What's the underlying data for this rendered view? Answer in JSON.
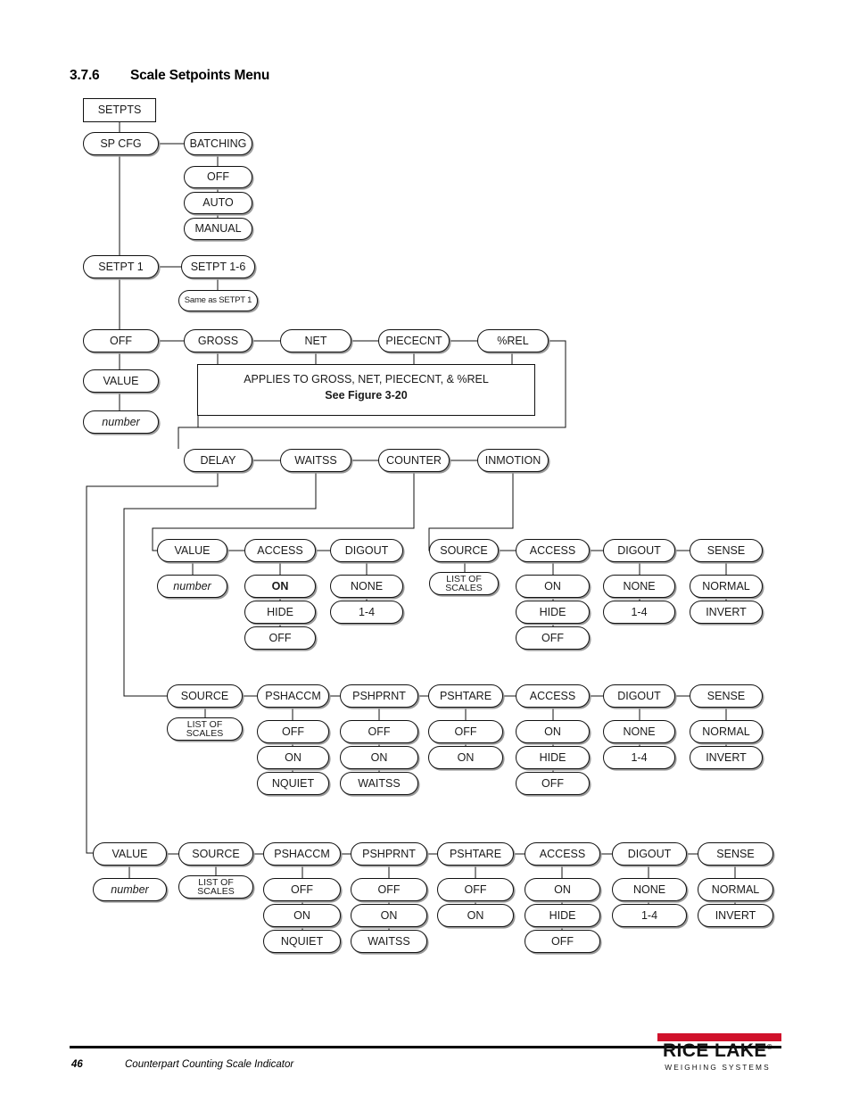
{
  "section": {
    "number": "3.7.6",
    "title": "Scale Setpoints Menu"
  },
  "footer": {
    "page": "46",
    "doc_title": "Counterpart Counting Scale Indicator",
    "logo_name": "RICE LAKE",
    "logo_tagline": "WEIGHING SYSTEMS",
    "logo_bar_color": "#d0112b"
  },
  "note": {
    "line1": "APPLIES TO GROSS, NET, PIECECNT, & %REL",
    "line2": "See Figure 3-20"
  },
  "nodes": {
    "setpts": "SETPTS",
    "sp_cfg": "SP CFG",
    "batching": "BATCHING",
    "batching_off": "OFF",
    "batching_auto": "AUTO",
    "batching_manual": "MANUAL",
    "setpt1": "SETPT 1",
    "setpt16": "SETPT 1-6",
    "same_as": "Same as SETPT 1",
    "off": "OFF",
    "gross": "GROSS",
    "net": "NET",
    "piececnt": "PIECECNT",
    "pctrel": "%REL",
    "value": "VALUE",
    "number": "number",
    "delay": "DELAY",
    "waitss": "WAITSS",
    "counter": "COUNTER",
    "inmotion": "INMOTION",
    "r1_value": "VALUE",
    "r1_number": "number",
    "r1_access": "ACCESS",
    "r1_access_on": "ON",
    "r1_access_hide": "HIDE",
    "r1_access_off": "OFF",
    "r1_digout": "DIGOUT",
    "r1_digout_none": "NONE",
    "r1_digout_14": "1-4",
    "r2_source": "SOURCE",
    "r2_list": "LIST OF SCALES",
    "r2_list_l1": "LIST OF",
    "r2_list_l2": "SCALES",
    "r2_access": "ACCESS",
    "r2_access_on": "ON",
    "r2_access_hide": "HIDE",
    "r2_access_off": "OFF",
    "r2_digout": "DIGOUT",
    "r2_digout_none": "NONE",
    "r2_digout_14": "1-4",
    "r2_sense": "SENSE",
    "r2_sense_normal": "NORMAL",
    "r2_sense_invert": "INVERT",
    "r3_source": "SOURCE",
    "r3_list_l1": "LIST OF",
    "r3_list_l2": "SCALES",
    "r3_pshaccm": "PSHACCM",
    "r3_pshaccm_off": "OFF",
    "r3_pshaccm_on": "ON",
    "r3_pshaccm_nquiet": "NQUIET",
    "r3_pshprnt": "PSHPRNT",
    "r3_pshprnt_off": "OFF",
    "r3_pshprnt_on": "ON",
    "r3_pshprnt_waitss": "WAITSS",
    "r3_pshtare": "PSHTARE",
    "r3_pshtare_off": "OFF",
    "r3_pshtare_on": "ON",
    "r3_access": "ACCESS",
    "r3_access_on": "ON",
    "r3_access_hide": "HIDE",
    "r3_access_off": "OFF",
    "r3_digout": "DIGOUT",
    "r3_digout_none": "NONE",
    "r3_digout_14": "1-4",
    "r3_sense": "SENSE",
    "r3_sense_normal": "NORMAL",
    "r3_sense_invert": "INVERT",
    "r4_value": "VALUE",
    "r4_number": "number",
    "r4_source": "SOURCE",
    "r4_list_l1": "LIST OF",
    "r4_list_l2": "SCALES",
    "r4_pshaccm": "PSHACCM",
    "r4_pshaccm_off": "OFF",
    "r4_pshaccm_on": "ON",
    "r4_pshaccm_nquiet": "NQUIET",
    "r4_pshprnt": "PSHPRNT",
    "r4_pshprnt_off": "OFF",
    "r4_pshprnt_on": "ON",
    "r4_pshprnt_waitss": "WAITSS",
    "r4_pshtare": "PSHTARE",
    "r4_pshtare_off": "OFF",
    "r4_pshtare_on": "ON",
    "r4_access": "ACCESS",
    "r4_access_on": "ON",
    "r4_access_hide": "HIDE",
    "r4_access_off": "OFF",
    "r4_digout": "DIGOUT",
    "r4_digout_none": "NONE",
    "r4_digout_14": "1-4",
    "r4_sense": "SENSE",
    "r4_sense_normal": "NORMAL",
    "r4_sense_invert": "INVERT"
  }
}
